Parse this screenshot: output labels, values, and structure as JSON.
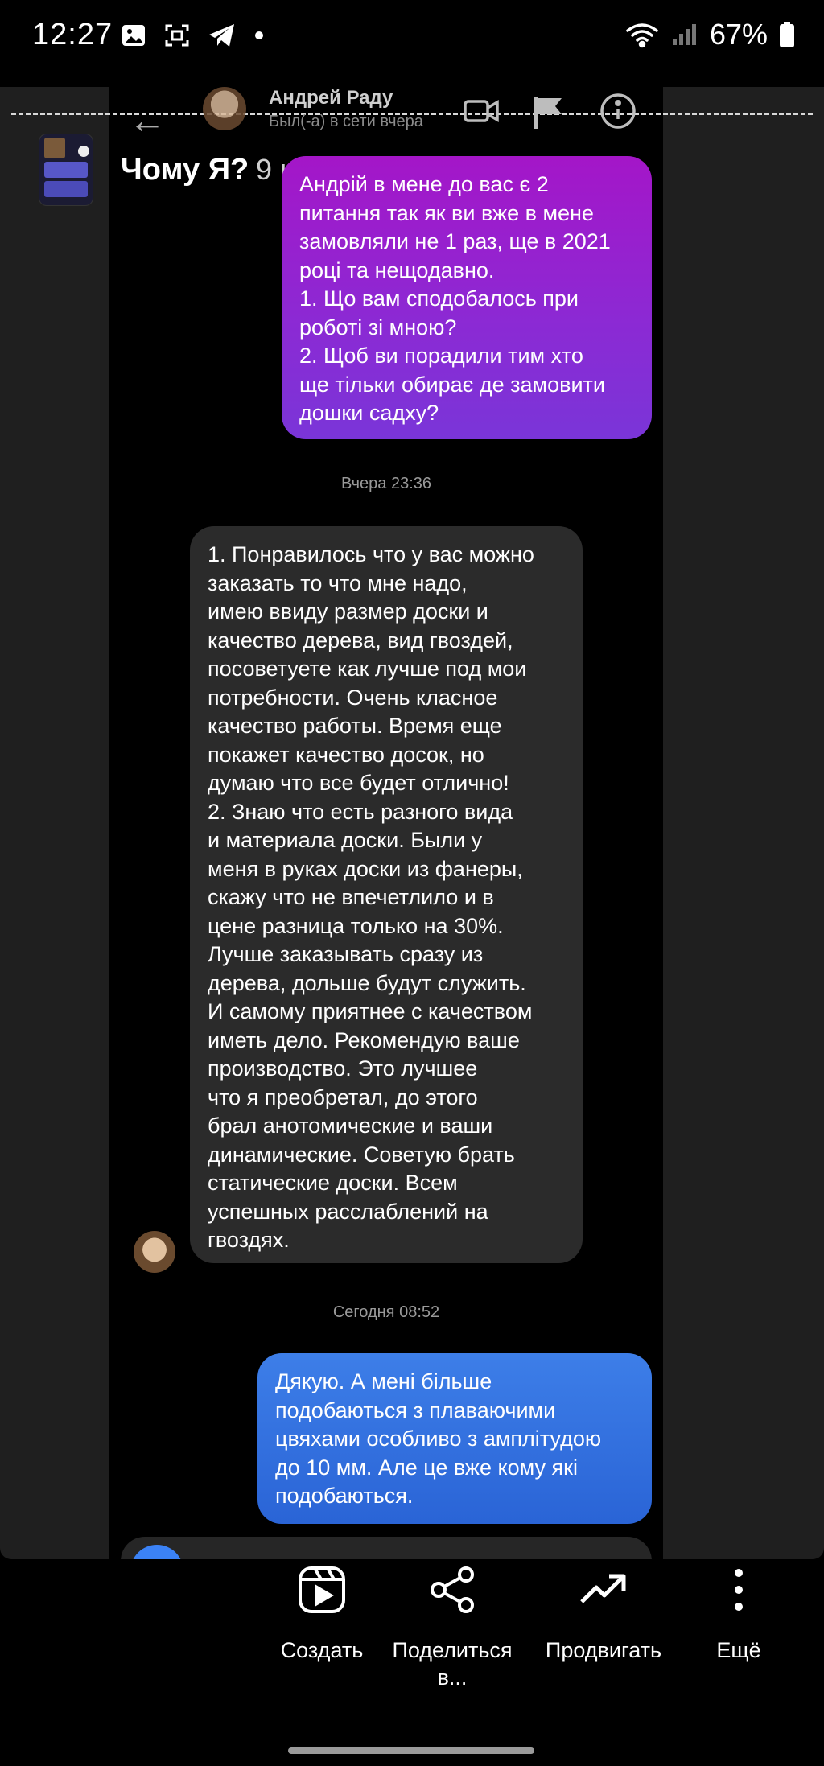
{
  "status_bar": {
    "time": "12:27",
    "battery": "67%",
    "icons": [
      "image-icon",
      "screenshot-icon",
      "telegram-icon",
      "dot-icon",
      "wifi-icon",
      "signal-icon",
      "battery-icon"
    ]
  },
  "chat_header": {
    "name": "Андрей Раду",
    "status": "Был(-а) в сети вчера",
    "icons": [
      "back-arrow-icon",
      "video-call-icon",
      "flag-icon",
      "info-icon"
    ]
  },
  "story": {
    "title": "Чому Я?",
    "age": "9 нед."
  },
  "messages": {
    "m1": "Андрій в мене до вас є 2\nпитання так як ви вже в мене\nзамовляли не 1 раз, ще в 2021\nроці та нещодавно.\n1. Що вам сподобалось при\nроботі зі мною?\n2. Щоб ви порадили тим хто\nще тільки обирає де замовити\nдошки садху?",
    "ts1": "Вчера 23:36",
    "m2": "1. Понравилось что у вас можно\nзаказать то что мне надо,\nимею ввиду размер доски и\nкачество дерева, вид гвоздей,\nпосоветуете как лучше под мои\nпотребности. Очень класное\nкачество работы. Время еще\nпокажет качество досок, но\nдумаю что все будет отлично!\n2. Знаю что есть разного вида\nи материала доски. Были у\nменя в руках доски из фанеры,\nскажу что не впечетлило и в\nцене разница только на 30%.\nЛучше заказывать сразу из\nдерева, дольше будут служить.\nИ самому приятнее с качеством\nиметь дело. Рекомендую ваше\nпроизводство. Это лучшее\nчто я преобретал, до этого\nбрал анотомические и ваши\nдинамические. Советую брать\nстатические доски. Всем\nуспешных расслаблений на\nгвоздях.",
    "ts2": "Сегодня 08:52",
    "m3": "Дякую. А мені більше\nподобаються з плаваючими\nцвяхами особливо з амплітудою\nдо 10 мм. Але це вже кому які\nподобаються."
  },
  "actions": [
    {
      "label": "Создать",
      "icon": "reels-create-icon"
    },
    {
      "label": "Поделиться\nв...",
      "icon": "share-icon"
    },
    {
      "label": "Продвигать",
      "icon": "trending-up-icon"
    },
    {
      "label": "Ещё",
      "icon": "more-vertical-icon"
    }
  ]
}
